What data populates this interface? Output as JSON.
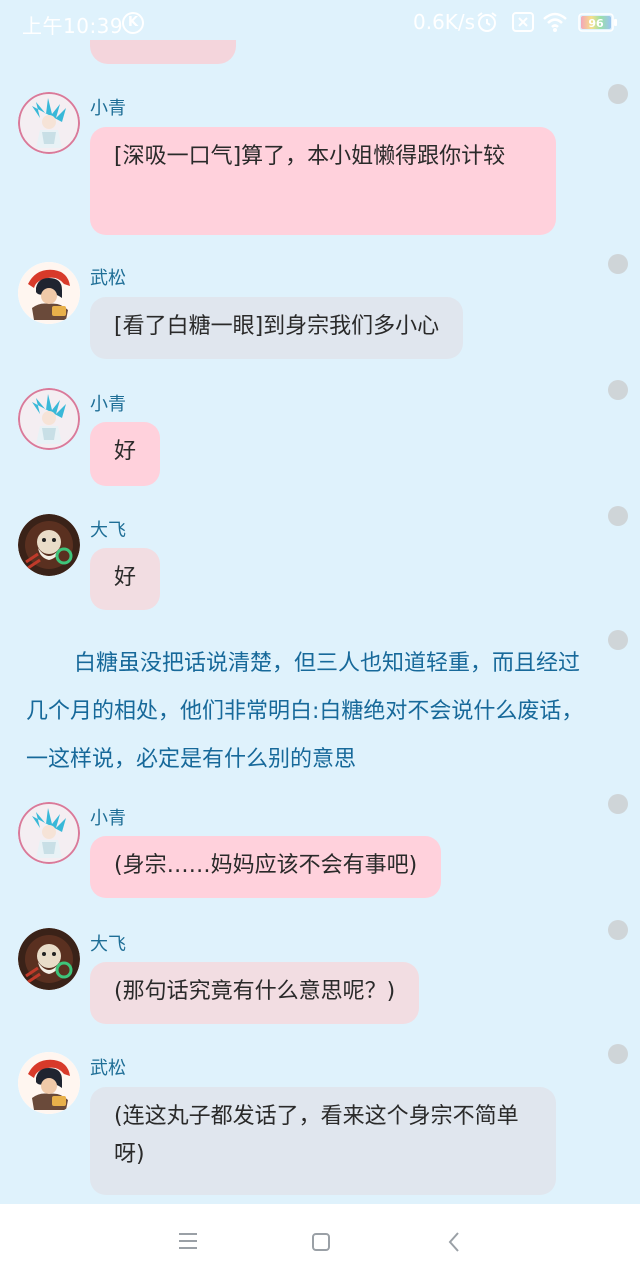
{
  "status_bar": {
    "time": "上午10:39",
    "k_badge": "K",
    "net_speed": "0.6K/s",
    "battery_level": "96",
    "icons": [
      "alarm-icon",
      "sim-icon",
      "wifi-icon",
      "battery-icon"
    ]
  },
  "messages": [
    {
      "sender": "小青",
      "text": "[深吸一口气]算了，本小姐懒得跟你计较"
    },
    {
      "sender": "武松",
      "text": "[看了白糖一眼]到身宗我们多小心"
    },
    {
      "sender": "小青",
      "text": "好"
    },
    {
      "sender": "大飞",
      "text": "好"
    },
    {
      "sender": "小青",
      "text": "(身宗……妈妈应该不会有事吧)"
    },
    {
      "sender": "大飞",
      "text": "(那句话究竟有什么意思呢？)"
    },
    {
      "sender": "武松",
      "text": "(连这丸子都发话了，看来这个身宗不简单呀)"
    }
  ],
  "narration": "白糖虽没把话说清楚，但三人也知道轻重，而且经过几个月的相处，他们非常明白:白糖绝对不会说什么废话，一这样说，必定是有什么别的意思",
  "nav_bar": {
    "icons": [
      "menu-icon",
      "home-icon",
      "back-icon"
    ]
  },
  "colors": {
    "background": "#dff2fc",
    "sender_name": "#1e6e96",
    "narration": "#17699a",
    "bubble_xiaoqing": "#ffd1dc",
    "bubble_dafei": "#f2dde2",
    "bubble_wusong": "#e0e6ee"
  }
}
